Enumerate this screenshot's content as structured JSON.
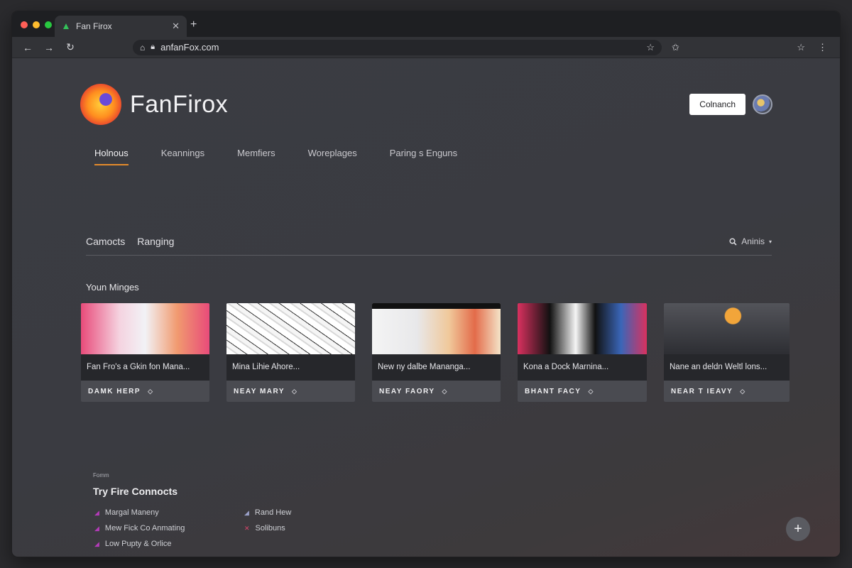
{
  "browser": {
    "tab_title": "Fan Firox",
    "tab_icon": "firefox-tab-icon",
    "url": "anfanFox.com",
    "traffic_lights": [
      "#ff5f57",
      "#febc2e",
      "#28c840"
    ]
  },
  "header": {
    "logo_text": "FanFirox",
    "launch_button": "Colnanch"
  },
  "main_nav": {
    "items": [
      "Holnous",
      "Keannings",
      "Memfiers",
      "Woreplages",
      "Paring s Enguns"
    ],
    "active_index": 0
  },
  "subnav": {
    "items": [
      "Camocts",
      "Ranging"
    ],
    "filter_label": "Aninis"
  },
  "section": {
    "title": "Youn Minges"
  },
  "cards": [
    {
      "title": "Fan Fro's a Gkin fon Mana...",
      "footer": "DAMK HERP",
      "palette": [
        "#e84b7a",
        "#f2f2f6",
        "#f19a6f"
      ]
    },
    {
      "title": "Mina Lihie Ahore...",
      "footer": "NEAY MARY",
      "palette": [
        "#ffffff",
        "#d8d8d8",
        "#222222"
      ]
    },
    {
      "title": "New ny dalbe Mananga...",
      "footer": "NEAY FAORY",
      "palette": [
        "#f4f4f4",
        "#f0c89a",
        "#e36b4a"
      ]
    },
    {
      "title": "Kona a Dock Marnina...",
      "footer": "BHANT FACY",
      "palette": [
        "#d9315f",
        "#111111",
        "#f5f5f5"
      ]
    },
    {
      "title": "Nane an deldn Weltl lons...",
      "footer": "NEAR T IEAVY",
      "palette": [
        "#53545a",
        "#2d2e33",
        "#f2a53a"
      ]
    }
  ],
  "footer": {
    "small_label": "Fomm",
    "title": "Try Fire Connocts",
    "links_left": [
      "Margal Maneny",
      "Mew Fick Co Anmating",
      "Low Pupty & Orlice"
    ],
    "links_right": [
      "Rand Hew",
      "Solibuns"
    ],
    "accent_color": "#b33bb8",
    "accent_color_alt": "#d9456b"
  }
}
